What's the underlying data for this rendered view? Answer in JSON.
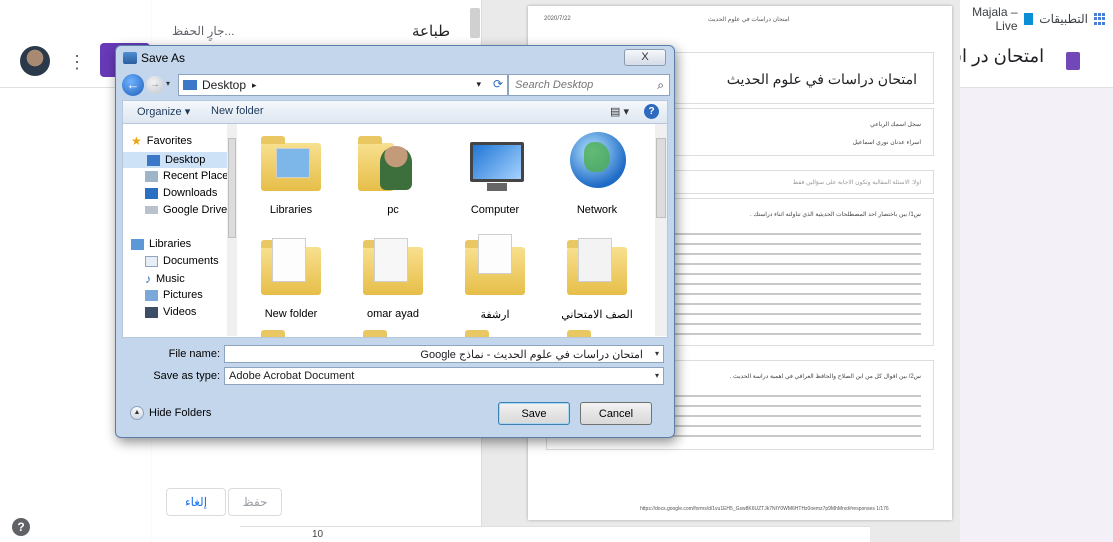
{
  "browser": {
    "bookmarks": {
      "apps_label": "التطبيقات",
      "majala_label": "Majala – Live"
    }
  },
  "forms_header": {
    "form_title": "امتحان در اس"
  },
  "print_panel": {
    "title": "طباعة",
    "status": "جارٍ الحفظ...",
    "cancel_label": "إلغاء",
    "save_label": "حفظ"
  },
  "preview": {
    "date": "2020/7/22",
    "header": "امتحان دراسات في علوم الحديث",
    "title": "امتحان دراسات في علوم الحديث",
    "name_label": "سجل اسمك الرباعي",
    "name_value": "اسراء عدنان نوري اسماعيل",
    "section_label": "اولا: الاسئلة المقالية وتكون الاجابة على سؤالين فقط",
    "q1": "س1/ بين باختصار احد المصطلحات الحديثية الذي تناولته اثناء دراستك .",
    "q2": "س2/ بين اقوال كل من ابن الصلاح والحافظ العراقي في اهمية دراسة الحديث .",
    "footer": "https://docs.google.com/forms/d/1vu1EH5_Gsw8K6UZTJk7NIY0WM6HTHz0oemz7p9MhMrxd#responses   1/176"
  },
  "ruler": {
    "number": "10"
  },
  "dialog": {
    "title": "Save As",
    "close_label": "X",
    "address": {
      "location": "Desktop",
      "separator": "▸"
    },
    "search": {
      "placeholder": "Search Desktop"
    },
    "toolbar": {
      "organize": "Organize ▾",
      "new_folder": "New folder",
      "help": "?"
    },
    "nav": {
      "favorites": "Favorites",
      "desktop": "Desktop",
      "recent_places": "Recent Places",
      "downloads": "Downloads",
      "google_drive": "Google Drive",
      "libraries": "Libraries",
      "documents": "Documents",
      "music": "Music",
      "pictures": "Pictures",
      "videos": "Videos"
    },
    "files": [
      {
        "label": "Libraries"
      },
      {
        "label": "pc"
      },
      {
        "label": "Computer"
      },
      {
        "label": "Network"
      },
      {
        "label": "New folder"
      },
      {
        "label": "omar ayad"
      },
      {
        "label": "ارشفة"
      },
      {
        "label": "الصف الامتحاني"
      }
    ],
    "file_name_label": "File name:",
    "file_name_value": "امتحان دراسات في علوم الحديث - نماذج Google",
    "save_type_label": "Save as type:",
    "save_type_value": "Adobe Acrobat Document",
    "hide_folders": "Hide Folders",
    "save_button": "Save",
    "cancel_button": "Cancel"
  },
  "help_icon": "?",
  "colors": {
    "forms_purple": "#673ab7",
    "dialog_frame": "#c3d6ec",
    "selection": "#cde1f7"
  }
}
